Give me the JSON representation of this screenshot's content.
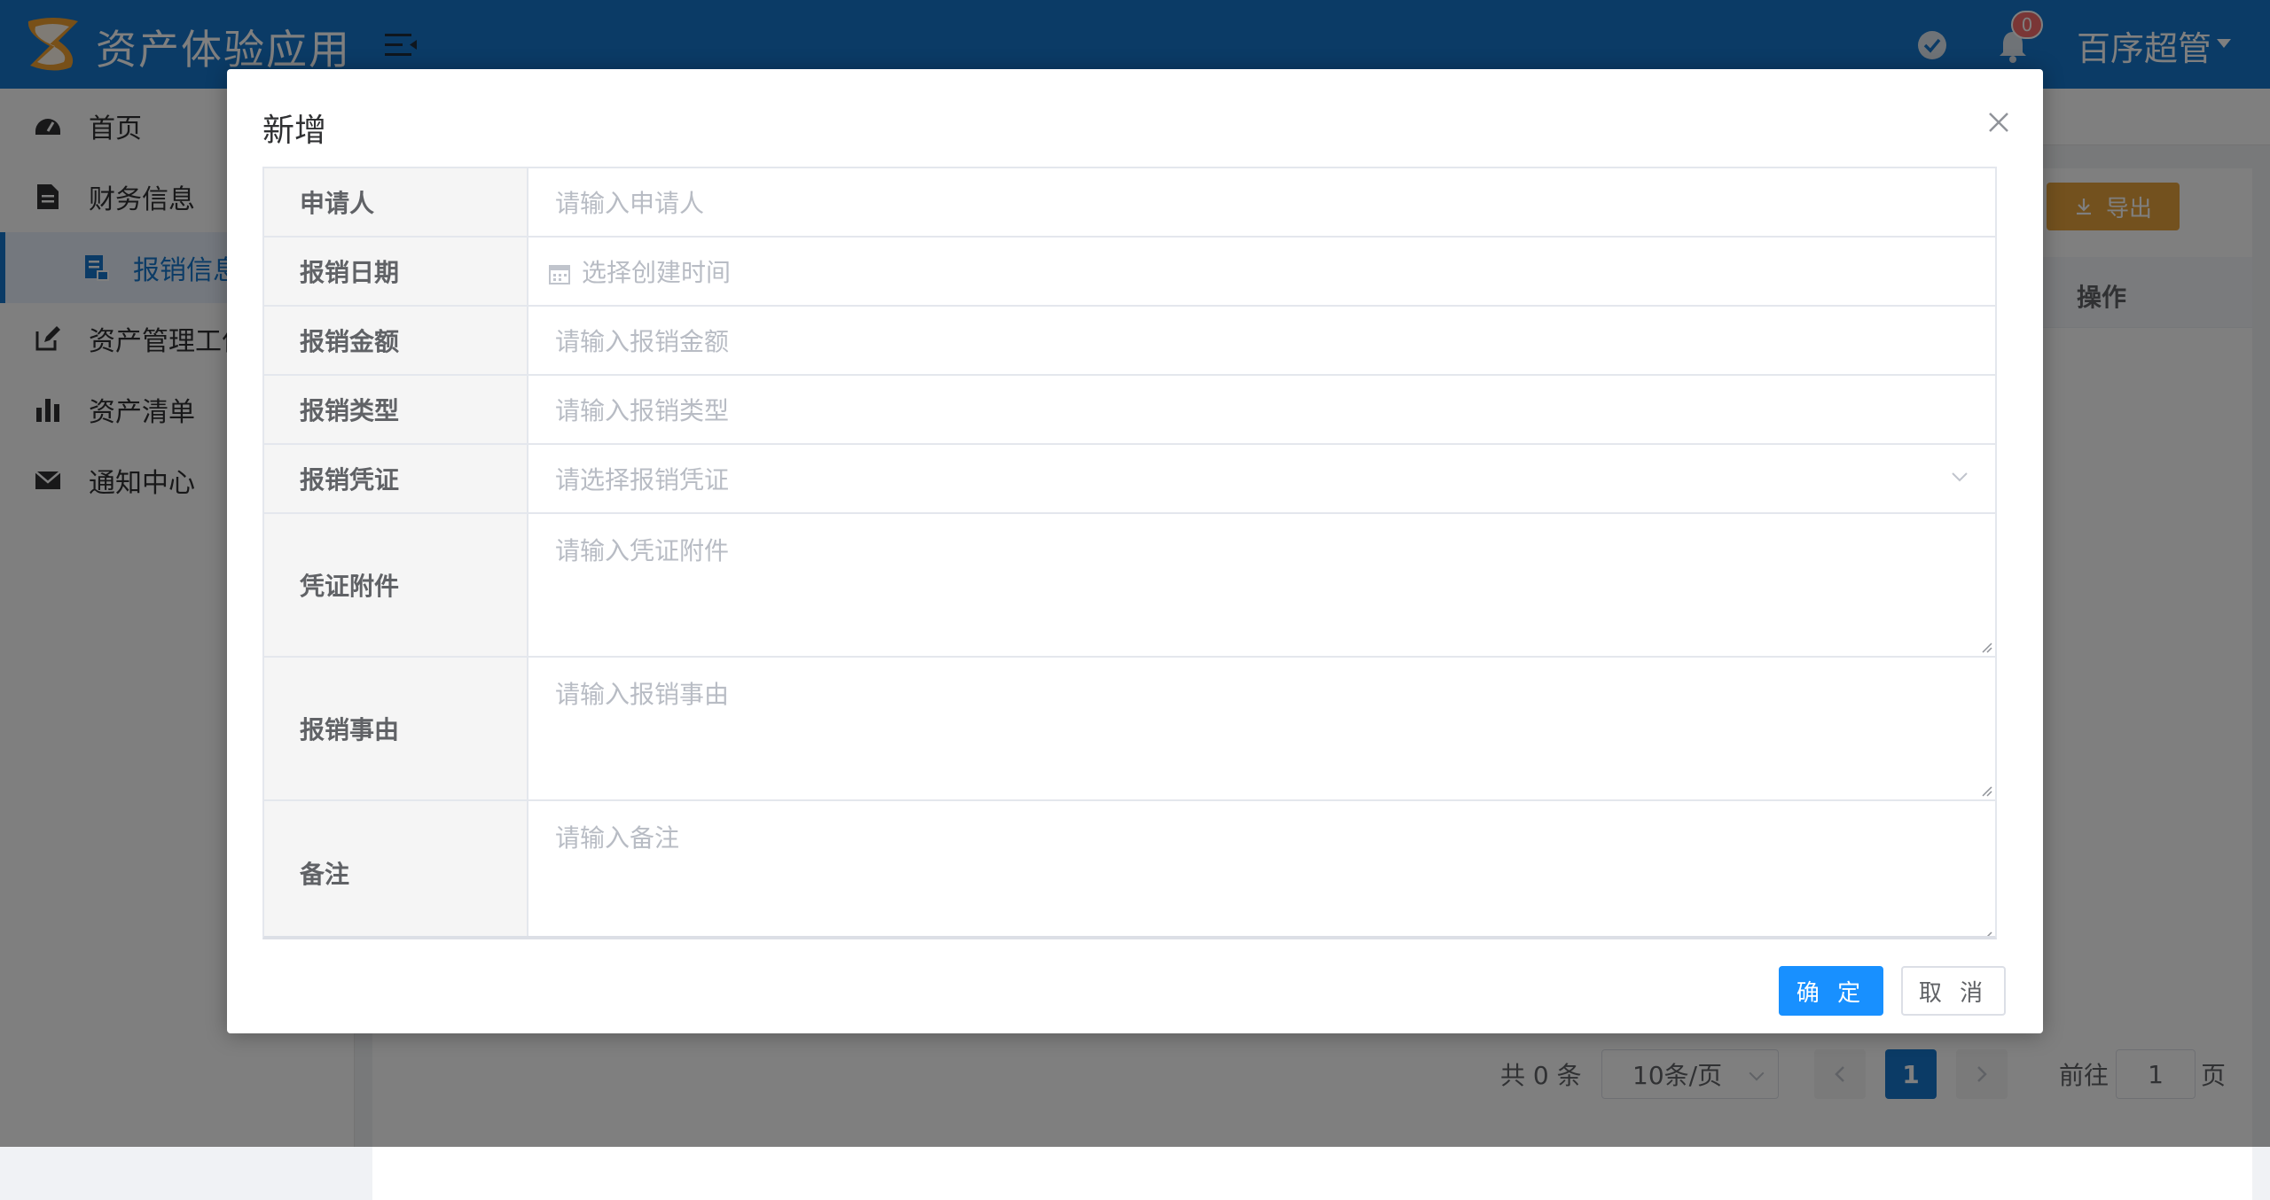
{
  "header": {
    "app_title": "资产体验应用",
    "notification_count": "0",
    "user_name": "百序超管"
  },
  "sidebar": {
    "items": [
      {
        "label": "首页",
        "icon": "dashboard-icon"
      },
      {
        "label": "财务信息",
        "icon": "document-icon"
      },
      {
        "label": "报销信息",
        "icon": "receipt-icon",
        "active": true
      },
      {
        "label": "资产管理工作",
        "icon": "edit-icon"
      },
      {
        "label": "资产清单",
        "icon": "bar-chart-icon"
      },
      {
        "label": "通知中心",
        "icon": "mail-icon"
      }
    ]
  },
  "main": {
    "export_label": "导出",
    "operation_header": "操作"
  },
  "pagination": {
    "total": "共 0 条",
    "page_size": "10条/页",
    "current_page": "1",
    "goto_label": "前往",
    "goto_value": "1",
    "page_suffix": "页"
  },
  "dialog": {
    "title": "新增",
    "fields": [
      {
        "label": "申请人",
        "placeholder": "请输入申请人",
        "type": "input"
      },
      {
        "label": "报销日期",
        "placeholder": "选择创建时间",
        "type": "date"
      },
      {
        "label": "报销金额",
        "placeholder": "请输入报销金额",
        "type": "input"
      },
      {
        "label": "报销类型",
        "placeholder": "请输入报销类型",
        "type": "input"
      },
      {
        "label": "报销凭证",
        "placeholder": "请选择报销凭证",
        "type": "select"
      },
      {
        "label": "凭证附件",
        "placeholder": "请输入凭证附件",
        "type": "textarea"
      },
      {
        "label": "报销事由",
        "placeholder": "请输入报销事由",
        "type": "textarea"
      },
      {
        "label": "备注",
        "placeholder": "请输入备注",
        "type": "textarea"
      }
    ],
    "confirm_label": "确 定",
    "cancel_label": "取 消"
  },
  "colors": {
    "header_bg": "#1677cc",
    "primary": "#1890ff",
    "warning": "#e6a23c",
    "badge": "#f56c6c"
  }
}
